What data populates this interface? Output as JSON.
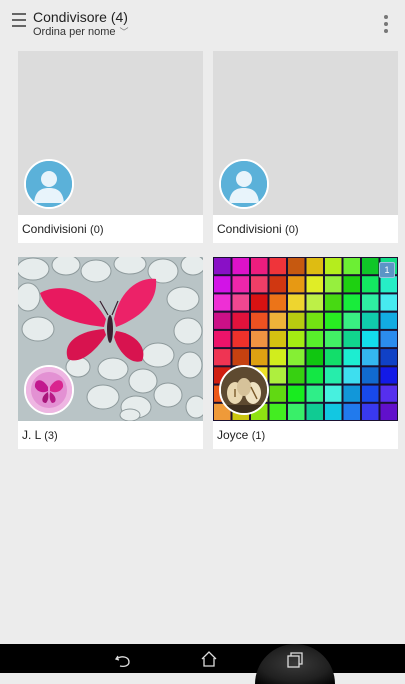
{
  "header": {
    "title": "Condivisore (4)",
    "sort_label": "Ordina per nome",
    "sort_chevron": "﹀"
  },
  "cards": [
    {
      "name": "Condivisioni",
      "count": "(0)",
      "image": "placeholder-gray",
      "avatar": "default-person-icon"
    },
    {
      "name": "Condivisioni",
      "count": "(0)",
      "image": "placeholder-gray",
      "avatar": "default-person-icon"
    },
    {
      "name": "J. L",
      "count": "(3)",
      "image": "pink-butterfly-on-pebbles",
      "avatar": "pink-butterfly-avatar"
    },
    {
      "name": "Joyce",
      "count": "(1)",
      "image": "rainbow-cubes",
      "avatar": "egg-art-avatar",
      "badge": "1"
    }
  ],
  "navbar": {
    "buttons": [
      "back-icon",
      "home-icon",
      "recents-icon"
    ]
  },
  "colors": {
    "background": "#ececec",
    "avatar_default": "#5bb1d9",
    "badge": "#5b95c6",
    "navbar": "#000000"
  }
}
